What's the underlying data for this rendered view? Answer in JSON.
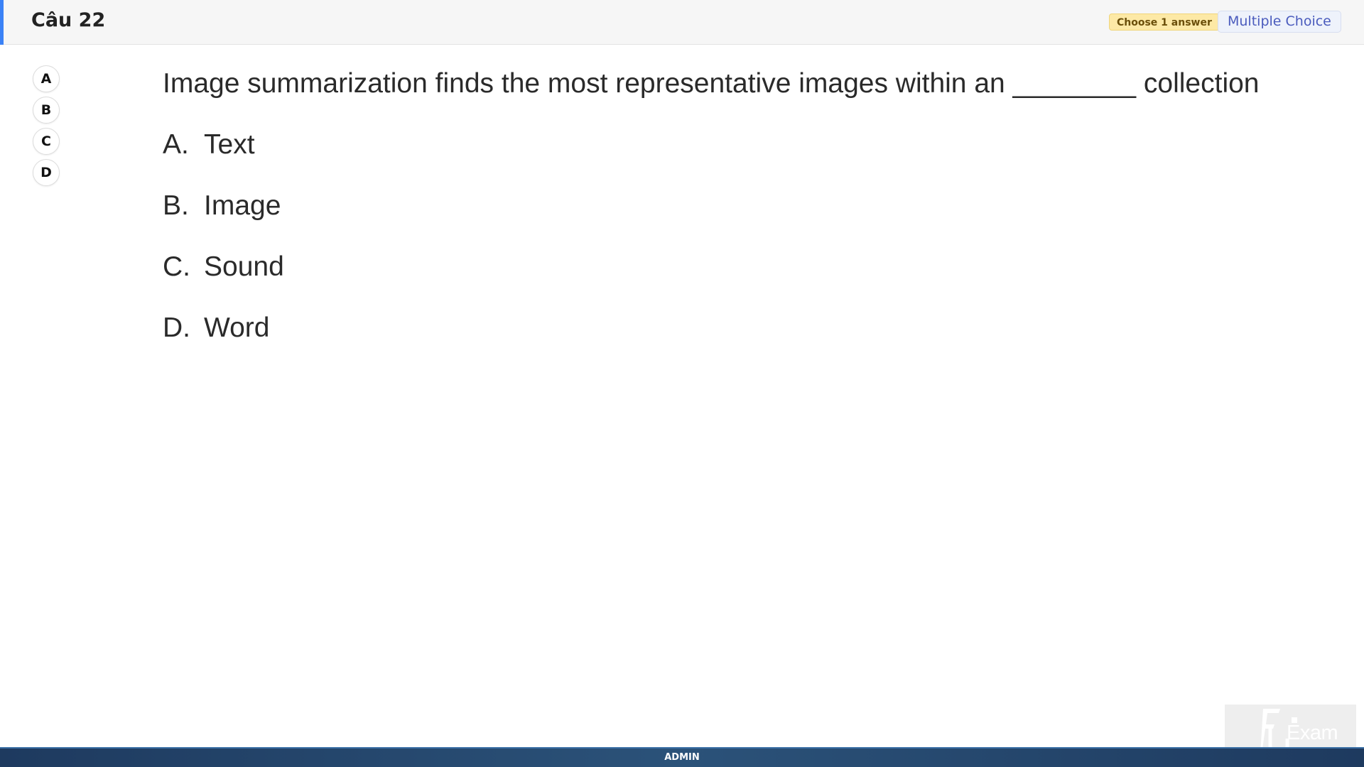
{
  "header": {
    "question_number": "Câu 22",
    "instruction_badge": "Choose 1 answer",
    "type_badge": "Multiple Choice",
    "accent_color": "#3b82f6"
  },
  "answer_bubbles": [
    "A",
    "B",
    "C",
    "D"
  ],
  "question": {
    "text": "Image summarization finds the most representative images within an ________ collection",
    "options": [
      {
        "letter": "A.",
        "text": "Text"
      },
      {
        "letter": "B.",
        "text": "Image"
      },
      {
        "letter": "C.",
        "text": "Sound"
      },
      {
        "letter": "D.",
        "text": "Word"
      }
    ]
  },
  "logo": {
    "text": "Exam",
    "icon": "fu-exam-logo-icon"
  },
  "footer": {
    "label": "ADMIN"
  }
}
